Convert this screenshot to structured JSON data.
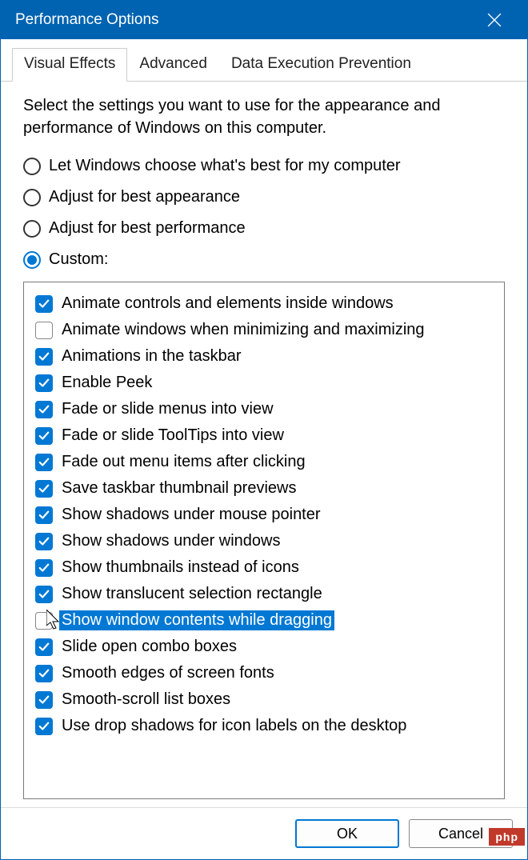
{
  "window": {
    "title": "Performance Options"
  },
  "tabs": [
    {
      "label": "Visual Effects",
      "active": true
    },
    {
      "label": "Advanced",
      "active": false
    },
    {
      "label": "Data Execution Prevention",
      "active": false
    }
  ],
  "description": "Select the settings you want to use for the appearance and performance of Windows on this computer.",
  "radios": [
    {
      "label": "Let Windows choose what's best for my computer",
      "checked": false
    },
    {
      "label": "Adjust for best appearance",
      "checked": false
    },
    {
      "label": "Adjust for best performance",
      "checked": false
    },
    {
      "label": "Custom:",
      "checked": true
    }
  ],
  "checkboxes": [
    {
      "label": "Animate controls and elements inside windows",
      "checked": true,
      "highlighted": false
    },
    {
      "label": "Animate windows when minimizing and maximizing",
      "checked": false,
      "highlighted": false
    },
    {
      "label": "Animations in the taskbar",
      "checked": true,
      "highlighted": false
    },
    {
      "label": "Enable Peek",
      "checked": true,
      "highlighted": false
    },
    {
      "label": "Fade or slide menus into view",
      "checked": true,
      "highlighted": false
    },
    {
      "label": "Fade or slide ToolTips into view",
      "checked": true,
      "highlighted": false
    },
    {
      "label": "Fade out menu items after clicking",
      "checked": true,
      "highlighted": false
    },
    {
      "label": "Save taskbar thumbnail previews",
      "checked": true,
      "highlighted": false
    },
    {
      "label": "Show shadows under mouse pointer",
      "checked": true,
      "highlighted": false
    },
    {
      "label": "Show shadows under windows",
      "checked": true,
      "highlighted": false
    },
    {
      "label": "Show thumbnails instead of icons",
      "checked": true,
      "highlighted": false
    },
    {
      "label": "Show translucent selection rectangle",
      "checked": true,
      "highlighted": false
    },
    {
      "label": "Show window contents while dragging",
      "checked": false,
      "highlighted": true
    },
    {
      "label": "Slide open combo boxes",
      "checked": true,
      "highlighted": false
    },
    {
      "label": "Smooth edges of screen fonts",
      "checked": true,
      "highlighted": false
    },
    {
      "label": "Smooth-scroll list boxes",
      "checked": true,
      "highlighted": false
    },
    {
      "label": "Use drop shadows for icon labels on the desktop",
      "checked": true,
      "highlighted": false
    }
  ],
  "buttons": {
    "ok": "OK",
    "cancel": "Cancel"
  },
  "watermark": "php"
}
